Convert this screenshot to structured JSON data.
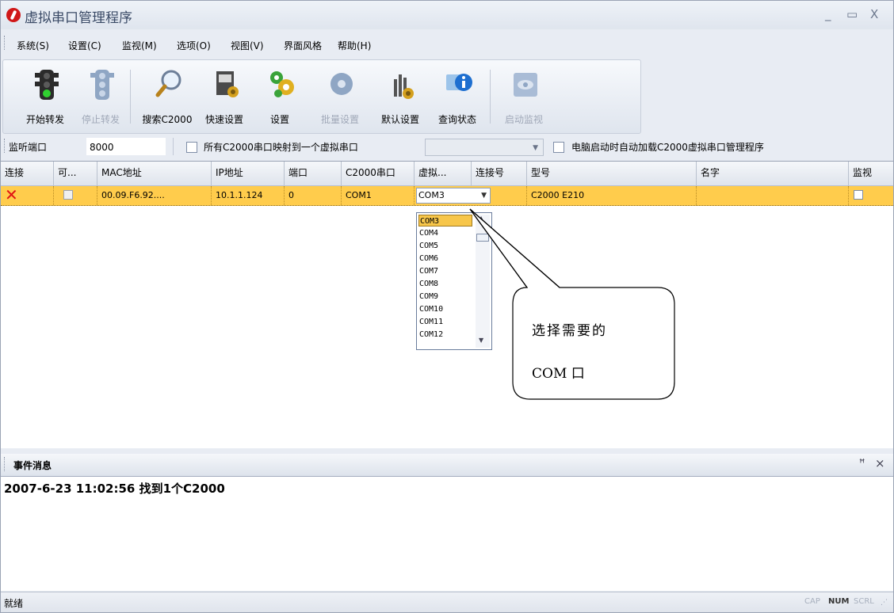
{
  "window": {
    "title": "虚拟串口管理程序",
    "minimize": "_",
    "maximize": "▭",
    "close": "X"
  },
  "menu": [
    "系统(S)",
    "设置(C)",
    "监视(M)",
    "选项(O)",
    "视图(V)",
    "界面风格",
    "帮助(H)"
  ],
  "toolbar": {
    "start": "开始转发",
    "stop": "停止转发",
    "search": "搜索C2000",
    "quick": "快速设置",
    "settings": "设置",
    "batch": "批量设置",
    "default": "默认设置",
    "status": "查询状态",
    "monitor": "启动监视"
  },
  "filter": {
    "port_label": "监听端口",
    "port_value": "8000",
    "map_all": "所有C2000串口映射到一个虚拟串口",
    "autoload": "电脑启动时自动加载C2000虚拟串口管理程序"
  },
  "grid": {
    "headers": [
      "连接",
      "可...",
      "MAC地址",
      "IP地址",
      "端口",
      "C2000串口",
      "虚拟...",
      "连接号",
      "型号",
      "名字",
      "监视"
    ],
    "row": {
      "mac": "00.09.F6.92....",
      "ip": "10.1.1.124",
      "port": "0",
      "c2000_port": "COM1",
      "virtual_port": "COM3",
      "model": "C2000 E210",
      "name": ""
    }
  },
  "dropdown": [
    "COM3",
    "COM4",
    "COM5",
    "COM6",
    "COM7",
    "COM8",
    "COM9",
    "COM10",
    "COM11",
    "COM12"
  ],
  "callout": {
    "line1": "选择需要的",
    "line2": "COM 口"
  },
  "events": {
    "title": "事件消息",
    "pin": "ꟷ",
    "close": "×",
    "message": "2007-6-23 11:02:56 找到1个C2000"
  },
  "status": {
    "ready": "就绪",
    "cap": "CAP",
    "num": "NUM",
    "scrl": "SCRL"
  },
  "colors": {
    "selected_row": "#ffcc4c",
    "disconnect_mark": "#e01414"
  }
}
